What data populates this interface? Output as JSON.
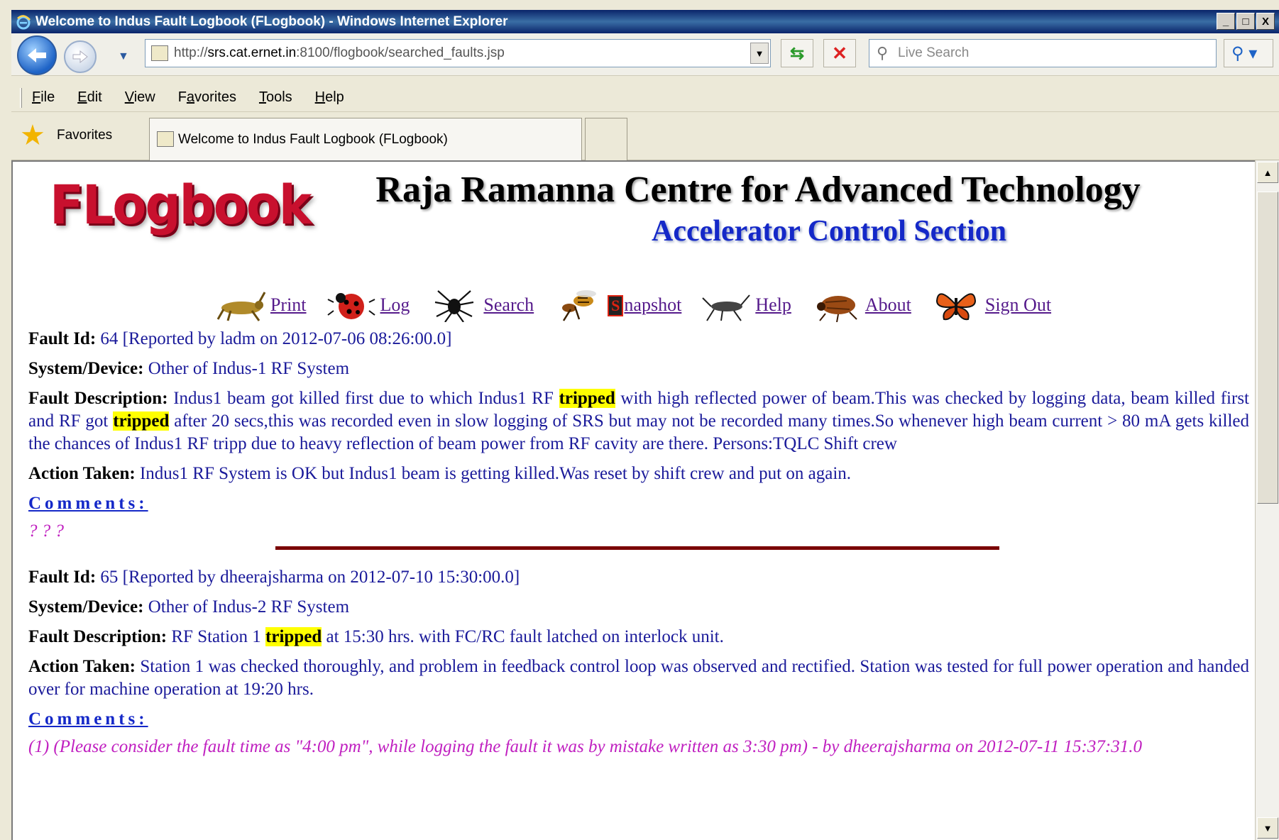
{
  "window": {
    "title": "Welcome to Indus Fault Logbook (FLogbook) - Windows Internet Explorer",
    "controls": [
      "_",
      "□",
      "X"
    ]
  },
  "navigation": {
    "address_prefix": "http://",
    "address_host": "srs.cat.ernet.in",
    "address_rest": ":8100/flogbook/searched_faults.jsp",
    "search_placeholder": "Live Search"
  },
  "menu": {
    "items": [
      {
        "pre": "",
        "key": "F",
        "post": "ile"
      },
      {
        "pre": "",
        "key": "E",
        "post": "dit"
      },
      {
        "pre": "",
        "key": "V",
        "post": "iew"
      },
      {
        "pre": "F",
        "key": "a",
        "post": "vorites"
      },
      {
        "pre": "",
        "key": "T",
        "post": "ools"
      },
      {
        "pre": "",
        "key": "H",
        "post": "elp"
      }
    ]
  },
  "favorites_bar": {
    "favorites_label": "Favorites",
    "tab_title": "Welcome to Indus Fault Logbook (FLogbook)"
  },
  "header": {
    "logo": "FLogbook",
    "org_title": "Raja Ramanna Centre for Advanced Technology",
    "section_title": "Accelerator Control Section"
  },
  "nav_links": {
    "print": "Print",
    "log": "Log",
    "search": "Search",
    "snapshot_s": "S",
    "snapshot_rest": "napshot",
    "help": "Help",
    "about": "About",
    "signout": "Sign Out"
  },
  "faults": [
    {
      "id_label": "Fault Id:",
      "id_text": " 64 [Reported by ladm on 2012-07-06 08:26:00.0]",
      "system_label": "System/Device:",
      "system_text": " Other of Indus-1 RF System",
      "desc_label": "Fault Description:",
      "desc_1": " Indus1 beam got killed first due to which Indus1 RF ",
      "desc_hl_1": "tripped",
      "desc_2": " with high reflected power of beam.This was checked by logging data, beam killed first and RF got ",
      "desc_hl_2": "tripped",
      "desc_3": " after 20 secs,this was recorded even in slow logging of SRS but may not be recorded many times.So whenever high beam current > 80 mA gets killed the chances of Indus1 RF tripp due to heavy reflection of beam power from RF cavity are there. Persons:TQLC Shift crew",
      "action_label": "Action Taken:",
      "action_text": " Indus1 RF System is OK but Indus1 beam is getting killed.Was reset by shift crew and put on again.",
      "comments_label": "Comments:",
      "comment_text": "? ? ?"
    },
    {
      "id_label": "Fault Id:",
      "id_text": " 65 [Reported by dheerajsharma on 2012-07-10 15:30:00.0]",
      "system_label": "System/Device:",
      "system_text": " Other of Indus-2 RF System",
      "desc_label": "Fault Description:",
      "desc_1": " RF Station 1 ",
      "desc_hl_1": "tripped",
      "desc_2": " at 15:30 hrs. with FC/RC fault latched on interlock unit.",
      "action_label": "Action Taken:",
      "action_text": " Station 1 was checked thoroughly, and problem in feedback control loop was observed and rectified. Station was tested for full power operation and handed over for machine operation at 19:20 hrs.",
      "comments_label": "Comments:",
      "comment_text": "(1) (Please consider the fault time as \"4:00 pm\", while logging the fault it was by mistake written as 3:30 pm) - by dheerajsharma on 2012-07-11 15:37:31.0"
    }
  ]
}
